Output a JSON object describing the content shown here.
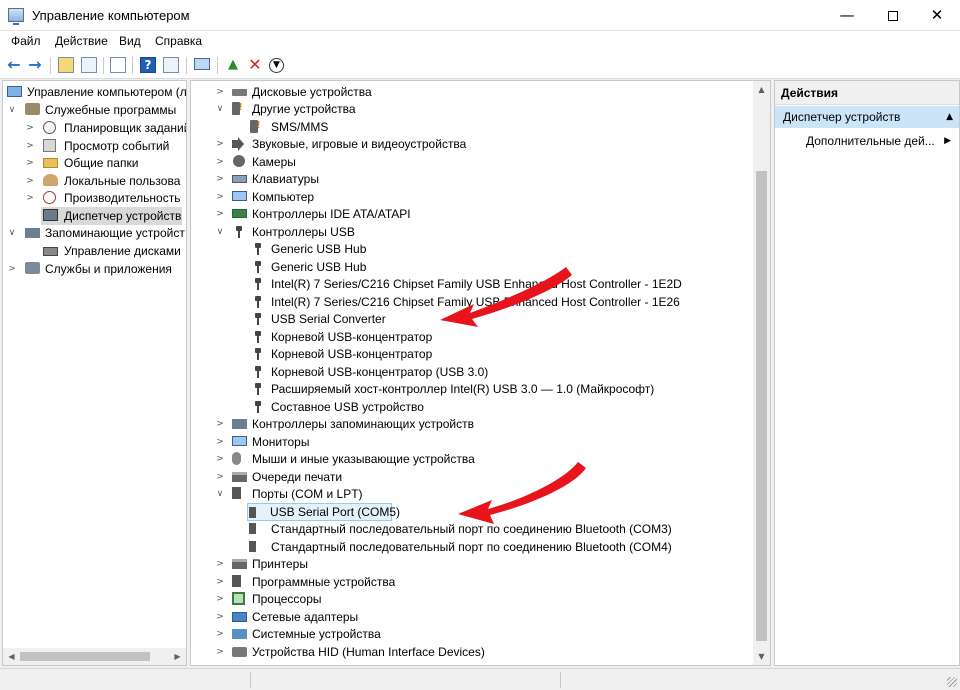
{
  "window": {
    "title": "Управление компьютером",
    "minimize": "—",
    "close": "✕"
  },
  "menu": {
    "file": "Файл",
    "action": "Действие",
    "view": "Вид",
    "help": "Справка"
  },
  "left_tree": [
    {
      "label": "Управление компьютером (л",
      "icon": "computer-management-icon"
    },
    {
      "label": "Служебные программы",
      "icon": "tools-icon"
    },
    {
      "label": "Планировщик заданий",
      "icon": "clock-icon"
    },
    {
      "label": "Просмотр событий",
      "icon": "event-log-icon"
    },
    {
      "label": "Общие папки",
      "icon": "shared-folder-icon"
    },
    {
      "label": "Локальные пользова",
      "icon": "users-icon"
    },
    {
      "label": "Производительность",
      "icon": "performance-icon"
    },
    {
      "label": "Диспетчер устройств",
      "icon": "device-manager-icon"
    },
    {
      "label": "Запоминающие устройст",
      "icon": "storage-icon"
    },
    {
      "label": "Управление дисками",
      "icon": "disk-icon"
    },
    {
      "label": "Службы и приложения",
      "icon": "services-icon"
    }
  ],
  "devices": [
    {
      "label": "Дисковые устройства",
      "icon": "disk-drive-icon"
    },
    {
      "label": "Другие устройства",
      "icon": "other-devices-icon"
    },
    {
      "label": "SMS/MMS",
      "icon": "unknown-device-icon"
    },
    {
      "label": "Звуковые, игровые и видеоустройства",
      "icon": "speaker-icon"
    },
    {
      "label": "Камеры",
      "icon": "camera-icon"
    },
    {
      "label": "Клавиатуры",
      "icon": "keyboard-icon"
    },
    {
      "label": "Компьютер",
      "icon": "computer-icon"
    },
    {
      "label": "Контроллеры IDE ATA/ATAPI",
      "icon": "ide-controller-icon"
    },
    {
      "label": "Контроллеры USB",
      "icon": "usb-icon"
    },
    {
      "label": "Generic USB Hub",
      "icon": "usb-icon"
    },
    {
      "label": "Generic USB Hub",
      "icon": "usb-icon"
    },
    {
      "label": "Intel(R) 7 Series/C216 Chipset Family USB Enhanced Host Controller - 1E2D",
      "icon": "usb-icon"
    },
    {
      "label": "Intel(R) 7 Series/C216 Chipset Family USB Enhanced Host Controller - 1E26",
      "icon": "usb-icon"
    },
    {
      "label": "USB Serial Converter",
      "icon": "usb-icon"
    },
    {
      "label": "Корневой USB-концентратор",
      "icon": "usb-icon"
    },
    {
      "label": "Корневой USB-концентратор",
      "icon": "usb-icon"
    },
    {
      "label": "Корневой USB-концентратор (USB 3.0)",
      "icon": "usb-icon"
    },
    {
      "label": "Расширяемый хост-контроллер Intel(R) USB 3.0 — 1.0 (Майкрософт)",
      "icon": "usb-icon"
    },
    {
      "label": "Составное USB устройство",
      "icon": "usb-icon"
    },
    {
      "label": "Контроллеры запоминающих устройств",
      "icon": "storage-controller-icon"
    },
    {
      "label": "Мониторы",
      "icon": "monitor-icon"
    },
    {
      "label": "Мыши и иные указывающие устройства",
      "icon": "mouse-icon"
    },
    {
      "label": "Очереди печати",
      "icon": "print-queue-icon"
    },
    {
      "label": "Порты (COM и LPT)",
      "icon": "port-icon"
    },
    {
      "label": "USB Serial Port (COM5)",
      "icon": "port-icon"
    },
    {
      "label": "Стандартный последовательный порт по соединению Bluetooth (COM3)",
      "icon": "port-icon"
    },
    {
      "label": "Стандартный последовательный порт по соединению Bluetooth (COM4)",
      "icon": "port-icon"
    },
    {
      "label": "Принтеры",
      "icon": "printer-icon"
    },
    {
      "label": "Программные устройства",
      "icon": "software-device-icon"
    },
    {
      "label": "Процессоры",
      "icon": "cpu-icon"
    },
    {
      "label": "Сетевые адаптеры",
      "icon": "network-adapter-icon"
    },
    {
      "label": "Системные устройства",
      "icon": "system-device-icon"
    },
    {
      "label": "Устройства HID (Human Interface Devices)",
      "icon": "hid-icon"
    }
  ],
  "actions": {
    "header": "Действия",
    "group": "Диспетчер устройств",
    "more": "Дополнительные дей..."
  },
  "colors": {
    "annotation_arrow": "#e8141c",
    "selection": "#cce4f7"
  }
}
